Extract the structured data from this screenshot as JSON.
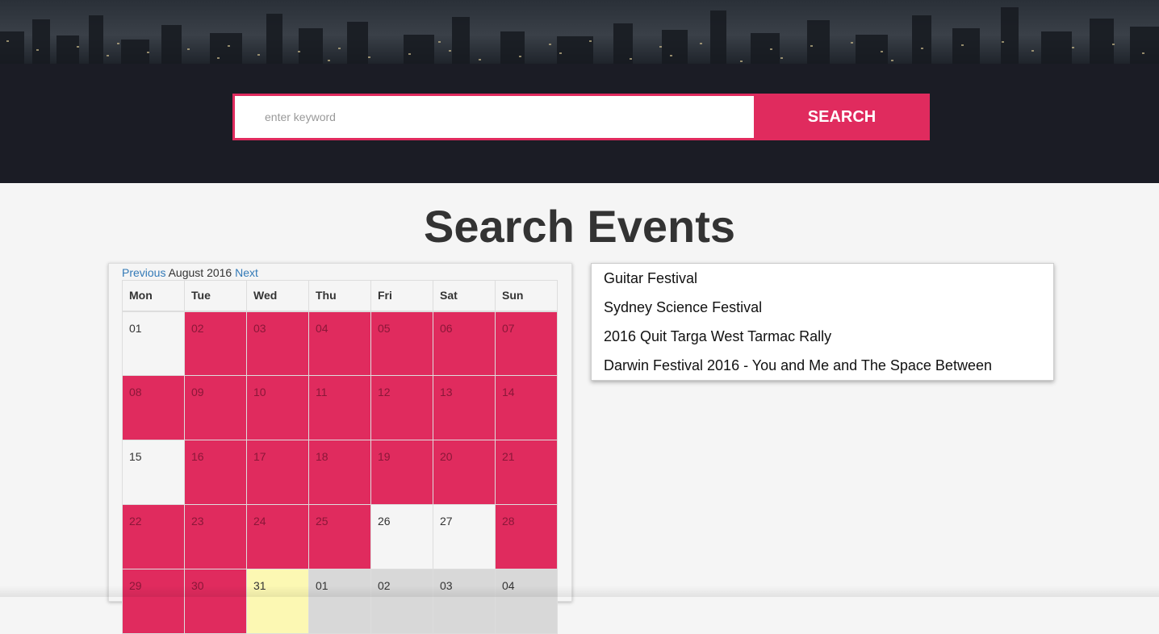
{
  "search": {
    "placeholder": "enter keyword",
    "value": "",
    "button_label": "SEARCH"
  },
  "heading": "Search Events",
  "calendar": {
    "prev_label": "Previous",
    "month_label": "August 2016",
    "next_label": "Next",
    "weekdays": [
      "Mon",
      "Tue",
      "Wed",
      "Thu",
      "Fri",
      "Sat",
      "Sun"
    ],
    "weeks": [
      [
        {
          "d": "01",
          "t": "empty"
        },
        {
          "d": "02",
          "t": "event"
        },
        {
          "d": "03",
          "t": "event"
        },
        {
          "d": "04",
          "t": "event"
        },
        {
          "d": "05",
          "t": "event"
        },
        {
          "d": "06",
          "t": "event"
        },
        {
          "d": "07",
          "t": "event"
        }
      ],
      [
        {
          "d": "08",
          "t": "event"
        },
        {
          "d": "09",
          "t": "event"
        },
        {
          "d": "10",
          "t": "event"
        },
        {
          "d": "11",
          "t": "event"
        },
        {
          "d": "12",
          "t": "event"
        },
        {
          "d": "13",
          "t": "event"
        },
        {
          "d": "14",
          "t": "event"
        }
      ],
      [
        {
          "d": "15",
          "t": "empty"
        },
        {
          "d": "16",
          "t": "event"
        },
        {
          "d": "17",
          "t": "event"
        },
        {
          "d": "18",
          "t": "event"
        },
        {
          "d": "19",
          "t": "event"
        },
        {
          "d": "20",
          "t": "event"
        },
        {
          "d": "21",
          "t": "event"
        }
      ],
      [
        {
          "d": "22",
          "t": "event"
        },
        {
          "d": "23",
          "t": "event"
        },
        {
          "d": "24",
          "t": "event"
        },
        {
          "d": "25",
          "t": "event"
        },
        {
          "d": "26",
          "t": "empty"
        },
        {
          "d": "27",
          "t": "empty"
        },
        {
          "d": "28",
          "t": "event"
        }
      ],
      [
        {
          "d": "29",
          "t": "event"
        },
        {
          "d": "30",
          "t": "event"
        },
        {
          "d": "31",
          "t": "today"
        },
        {
          "d": "01",
          "t": "other"
        },
        {
          "d": "02",
          "t": "other"
        },
        {
          "d": "03",
          "t": "other"
        },
        {
          "d": "04",
          "t": "other"
        }
      ]
    ]
  },
  "events": [
    "Guitar Festival",
    "Sydney Science Festival",
    "2016 Quit Targa West Tarmac Rally",
    "Darwin Festival 2016 - You and Me and The Space Between"
  ],
  "colors": {
    "accent": "#e02b5e",
    "band": "#1b1c25",
    "today": "#fcf8b3",
    "other_month": "#d8d8d8"
  }
}
